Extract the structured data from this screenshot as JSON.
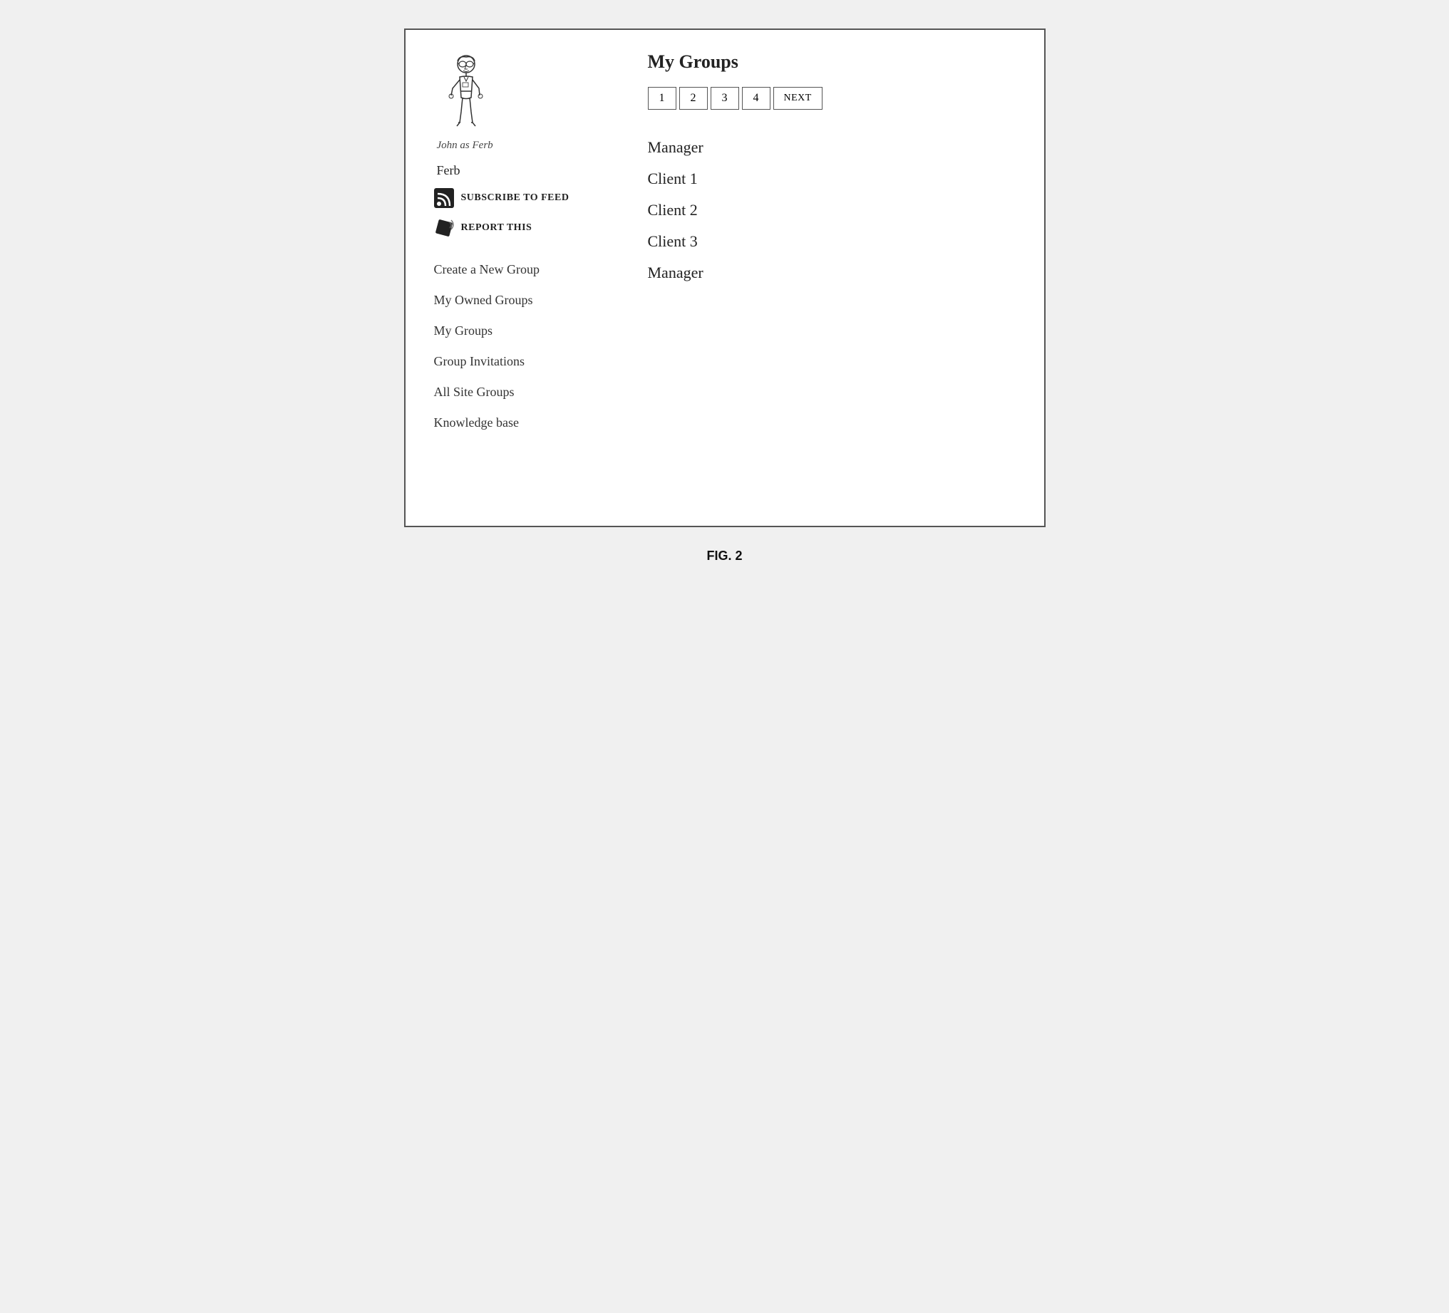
{
  "figure": {
    "caption": "FIG. 2"
  },
  "sidebar": {
    "character_name": "Ferb",
    "character_subtitle": "John as Ferb",
    "subscribe_label": "SUBSCRIBE TO FEED",
    "report_label": "REPORT THIS",
    "nav_items": [
      {
        "label": "Create a New Group",
        "id": "create-new-group"
      },
      {
        "label": "My Owned Groups",
        "id": "my-owned-groups"
      },
      {
        "label": "My Groups",
        "id": "my-groups"
      },
      {
        "label": "Group Invitations",
        "id": "group-invitations"
      },
      {
        "label": "All Site Groups",
        "id": "all-site-groups"
      },
      {
        "label": "Knowledge base",
        "id": "knowledge-base"
      }
    ]
  },
  "main": {
    "title": "My Groups",
    "pagination": {
      "pages": [
        "1",
        "2",
        "3",
        "4"
      ],
      "next_label": "NEXT"
    },
    "groups": [
      {
        "name": "Manager",
        "id": "group-manager-1"
      },
      {
        "name": "Client 1",
        "id": "group-client-1"
      },
      {
        "name": "Client 2",
        "id": "group-client-2"
      },
      {
        "name": "Client 3",
        "id": "group-client-3"
      },
      {
        "name": "Manager",
        "id": "group-manager-2"
      }
    ]
  }
}
